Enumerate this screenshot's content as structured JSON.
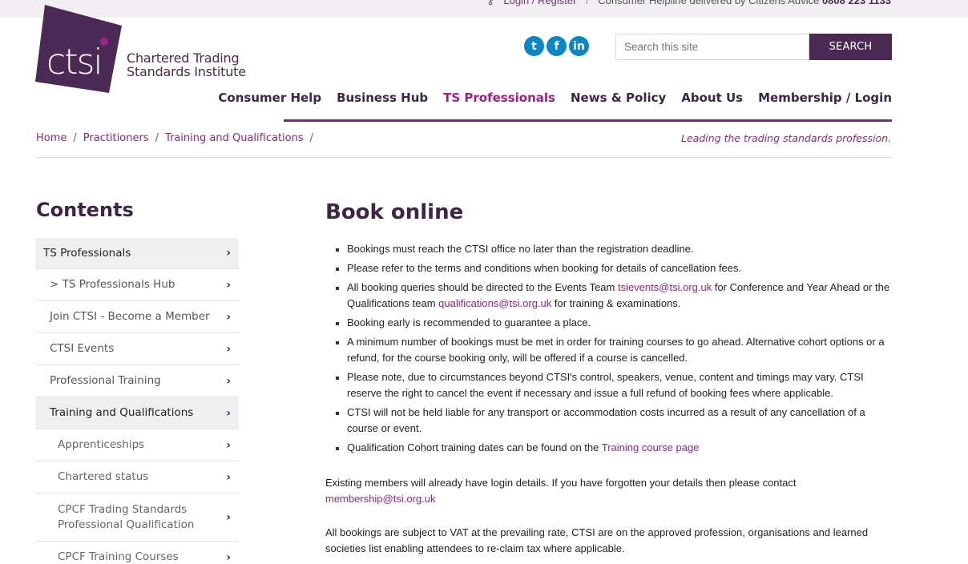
{
  "topbar": {
    "login_register": "Login / Register",
    "helpline": "Consumer Helpline delivered by Citizens Advice",
    "phone": "0808 223 1133"
  },
  "logo": {
    "mark": "ctsi",
    "line1": "Chartered Trading",
    "line2": "Standards Institute"
  },
  "social": [
    {
      "icon": "twitter-icon",
      "glyph": "t"
    },
    {
      "icon": "facebook-icon",
      "glyph": "f"
    },
    {
      "icon": "linkedin-icon",
      "glyph": "in"
    }
  ],
  "search": {
    "placeholder": "Search this site",
    "button": "SEARCH"
  },
  "nav": {
    "items": [
      {
        "label": "Consumer Help",
        "active": false
      },
      {
        "label": "Business Hub",
        "active": false
      },
      {
        "label": "TS Professionals",
        "active": true
      },
      {
        "label": "News & Policy",
        "active": false
      },
      {
        "label": "About Us",
        "active": false
      },
      {
        "label": "Membership / Login",
        "active": false
      }
    ]
  },
  "breadcrumb": {
    "home": "Home",
    "practitioners": "Practitioners",
    "training": "Training and Qualifications",
    "sep": "/"
  },
  "tagline": "Leading the trading standards profession.",
  "sidebar": {
    "heading": "Contents",
    "items": [
      {
        "label": "TS Professionals",
        "lines": [
          "TS Professionals"
        ],
        "level": 0
      },
      {
        "label": "> TS Professionals Hub",
        "lines": [
          "> TS Professionals Hub"
        ],
        "level": 1
      },
      {
        "label": "Join CTSI - Become a Member",
        "lines": [
          "Join CTSI - Become a Member"
        ],
        "level": 1
      },
      {
        "label": "CTSI Events",
        "lines": [
          "CTSI Events"
        ],
        "level": 1
      },
      {
        "label": "Professional Training",
        "lines": [
          "Professional Training"
        ],
        "level": 1
      },
      {
        "label": "Training and Qualifications",
        "lines": [
          "Training and Qualifications"
        ],
        "level": 1,
        "shaded": true
      },
      {
        "label": "Apprenticeships",
        "lines": [
          "Apprenticeships"
        ],
        "level": 2
      },
      {
        "label": "Chartered status",
        "lines": [
          "Chartered status"
        ],
        "level": 2
      },
      {
        "label": "CPCF Trading Standards Professional Qualification",
        "lines": [
          "CPCF Trading Standards",
          "Professional Qualification"
        ],
        "level": 2
      },
      {
        "label": "CPCF Training Courses",
        "lines": [
          "CPCF Training Courses"
        ],
        "level": 2
      }
    ]
  },
  "main": {
    "title": "Book online",
    "bullets": [
      {
        "text": [
          "Bookings must reach the CTSI office no later than the registration deadline."
        ]
      },
      {
        "text": [
          "Please refer to the terms and conditions when booking for details of cancellation fees."
        ]
      },
      {
        "text": [
          "All booking queries should be directed to the Events Team ",
          "tsievents@tsi.org.uk",
          " for Conference and Year Ahead or the Qualifications team ",
          "qualifications@tsi.org.uk",
          " for training & examinations."
        ],
        "links": [
          1,
          3
        ]
      },
      {
        "text": [
          "Booking early is recommended to guarantee a place."
        ]
      },
      {
        "text": [
          "A minimum number of bookings must be met in order for training courses to go ahead. Alternative cohort options or a refund, for the course booking only, will be offered if a course is cancelled."
        ]
      },
      {
        "text": [
          "Please note, due to circumstances beyond CTSI's control, speakers, venue, content and timings may vary. CTSI reserve the right to cancel the event if necessary and issue a full refund of booking fees where applicable."
        ]
      },
      {
        "text": [
          "CTSI will not be held liable for any transport or accommodation costs incurred as a result of any cancellation of a course or event."
        ]
      },
      {
        "text": [
          "Qualification Cohort training dates can be found on the ",
          "Training course page"
        ],
        "links": [
          1
        ]
      }
    ],
    "para1_text": "Existing members will already have login details. If you have forgotten your details then please contact",
    "para1_link": "membership@tsi.org.uk",
    "para2_text": "All bookings are subject to VAT at the prevailing rate, CTSI are on the approved profession, organisations and learned societies list enabling attendees to re-claim tax where applicable."
  },
  "colors": {
    "brand_purple": "#4a2a55",
    "link_magenta": "#8b2a7f",
    "active_nav": "#a01e84",
    "social_blue": "#0a86c8"
  }
}
